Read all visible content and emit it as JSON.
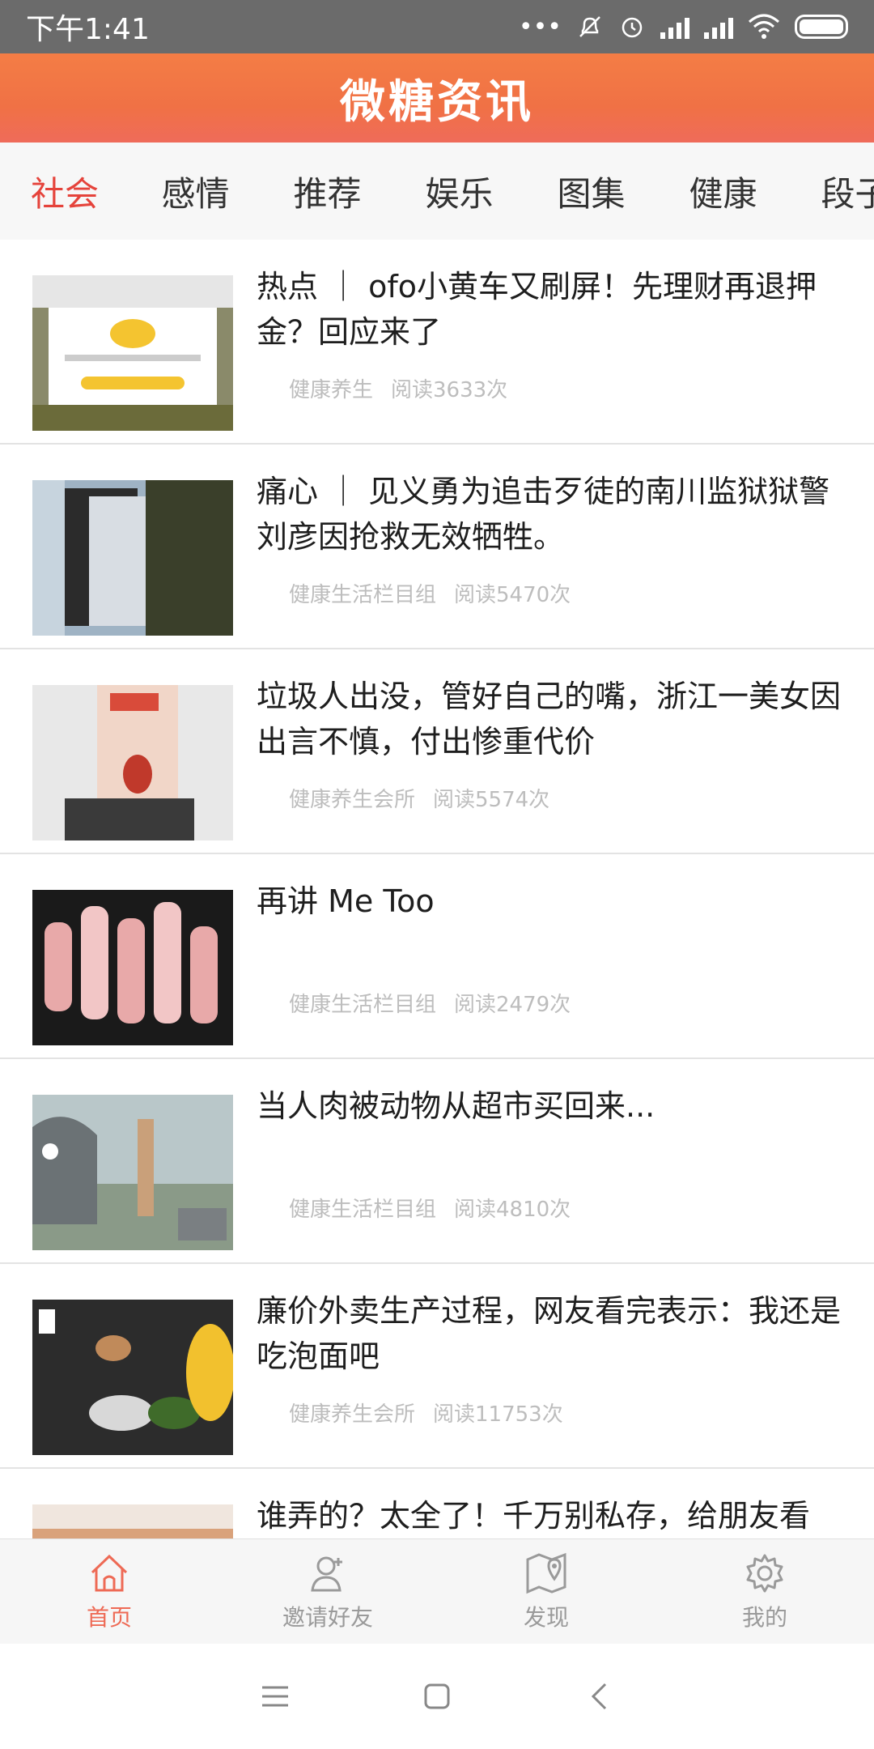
{
  "status_bar": {
    "time": "下午1:41",
    "dots": "•••"
  },
  "header": {
    "title": "微糖资讯",
    "accent_color": "#f07145"
  },
  "tabs": [
    {
      "label": "社会",
      "active": true
    },
    {
      "label": "感情",
      "active": false
    },
    {
      "label": "推荐",
      "active": false
    },
    {
      "label": "娱乐",
      "active": false
    },
    {
      "label": "图集",
      "active": false
    },
    {
      "label": "健康",
      "active": false
    },
    {
      "label": "段子",
      "active": false
    }
  ],
  "articles": [
    {
      "title": "热点 ｜ ofo小黄车又刷屏！先理财再退押金？回应来了",
      "source": "健康养生",
      "reads": "阅读3633次"
    },
    {
      "title": "痛心 ｜ 见义勇为追击歹徒的南川监狱狱警刘彦因抢救无效牺牲。",
      "source": "健康生活栏目组",
      "reads": "阅读5470次"
    },
    {
      "title": "垃圾人出没，管好自己的嘴，浙江一美女因出言不慎，付出惨重代价",
      "source": "健康养生会所",
      "reads": "阅读5574次"
    },
    {
      "title": "再讲 Me Too",
      "source": "健康生活栏目组",
      "reads": "阅读2479次"
    },
    {
      "title": "当人肉被动物从超市买回来...",
      "source": "健康生活栏目组",
      "reads": "阅读4810次"
    },
    {
      "title": "廉价外卖生产过程，网友看完表示：我还是吃泡面吧",
      "source": "健康养生会所",
      "reads": "阅读11753次"
    },
    {
      "title": "谁弄的？太全了！千万别私存，给朋友看",
      "source": "",
      "reads": ""
    }
  ],
  "bottom_nav": [
    {
      "label": "首页",
      "icon": "home-icon",
      "active": true
    },
    {
      "label": "邀请好友",
      "icon": "add-user-icon",
      "active": false
    },
    {
      "label": "发现",
      "icon": "map-icon",
      "active": false
    },
    {
      "label": "我的",
      "icon": "gear-icon",
      "active": false
    }
  ],
  "colors": {
    "active_tab": "#e5433b",
    "active_nav": "#ee6a55",
    "meta_text": "#bdbdbd"
  }
}
